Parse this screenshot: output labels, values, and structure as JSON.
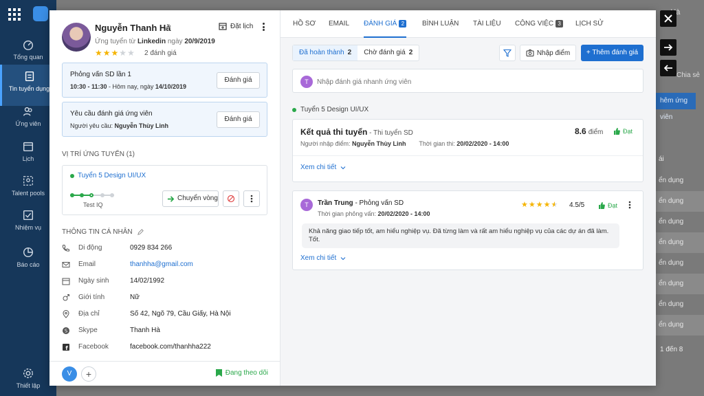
{
  "background": {
    "sidebar": [
      {
        "label": "Tổng quan",
        "icon": "dashboard-icon"
      },
      {
        "label": "Tin tuyển dụng",
        "icon": "jobs-icon"
      },
      {
        "label": "Ứng viên",
        "icon": "candidates-icon"
      },
      {
        "label": "Lịch",
        "icon": "calendar-icon"
      },
      {
        "label": "Talent pools",
        "icon": "talent-pool-icon"
      },
      {
        "label": "Nhiệm vụ",
        "icon": "tasks-icon"
      },
      {
        "label": "Báo cáo",
        "icon": "report-icon"
      },
      {
        "label": "Thiết lập",
        "icon": "settings-icon"
      }
    ],
    "topright_text": "ng Hà",
    "share_text": "Chia sẻ",
    "add_candidate_button": "hêm ứng viên",
    "col_header": "ái",
    "rows": [
      "ển dụng",
      "ển dụng",
      "ển dụng",
      "ển dụng",
      "ển dụng",
      "ển dụng",
      "ển dụng",
      "ển dụng",
      "ển dụng"
    ],
    "pager": "1 đến 8"
  },
  "candidate": {
    "name": "Nguyễn Thanh Hà",
    "applied_prefix": "Ứng tuyển từ",
    "source": "Linkedin",
    "applied_mid": "ngày",
    "applied_date": "20/9/2019",
    "rating_stars": 3,
    "rating_label": "2 đánh giá",
    "schedule_label": "Đặt lịch"
  },
  "interview_card": {
    "title": "Phỏng vấn SD lần 1",
    "time": "10:30 - 11:30",
    "day_prefix": " - Hôm nay, ngày ",
    "date": "14/10/2019",
    "button": "Đánh giá"
  },
  "request_card": {
    "title": "Yêu cầu đánh giá ứng viên",
    "requester_prefix": "Người yêu cầu: ",
    "requester": "Nguyễn Thùy Linh",
    "button": "Đánh giá"
  },
  "position": {
    "section_title": "VỊ TRÍ ỨNG TUYỂN (1)",
    "name": "Tuyển 5 Design UI/UX",
    "current_step": "Test IQ",
    "move_button": "Chuyển vòng"
  },
  "personal": {
    "section_title": "THÔNG TIN CÁ NHÂN",
    "fields": [
      {
        "label": "Di động",
        "value": "0929 834 266",
        "icon": "phone-icon"
      },
      {
        "label": "Email",
        "value": "thanhha@gmail.com",
        "icon": "mail-icon"
      },
      {
        "label": "Ngày sinh",
        "value": "14/02/1992",
        "icon": "calendar-icon"
      },
      {
        "label": "Giới tính",
        "value": "Nữ",
        "icon": "gender-icon"
      },
      {
        "label": "Địa chỉ",
        "value": "Số 42, Ngõ 79, Cầu Giấy, Hà Nội",
        "icon": "location-icon"
      },
      {
        "label": "Skype",
        "value": "Thanh Hà",
        "icon": "skype-icon"
      },
      {
        "label": "Facebook",
        "value": "facebook.com/thanhha222",
        "icon": "facebook-icon"
      }
    ]
  },
  "footer": {
    "avatar_initial": "V",
    "follow_label": "Đang theo dõi"
  },
  "tabs": [
    {
      "label": "HỒ SƠ"
    },
    {
      "label": "EMAIL"
    },
    {
      "label": "ĐÁNH GIÁ",
      "badge": "2"
    },
    {
      "label": "BÌNH LUẬN"
    },
    {
      "label": "TÀI LIỆU"
    },
    {
      "label": "CÔNG VIỆC",
      "badge": "3"
    },
    {
      "label": "LỊCH SỬ"
    }
  ],
  "filters": {
    "completed_label": "Đã hoàn thành",
    "completed_count": "2",
    "pending_label": "Chờ đánh giá",
    "pending_count": "2",
    "import_score": "Nhập điểm",
    "add_eval": "+ Thêm đánh giá"
  },
  "quick_eval": {
    "avatar_initial": "T",
    "placeholder": "Nhập đánh giá nhanh ứng viên"
  },
  "group_label": "Tuyển 5 Design UI/UX",
  "result": {
    "title": "Kết quả thi tuyển",
    "subtitle": " - Thi tuyển SD",
    "entered_by_label": "Người nhập điểm: ",
    "entered_by": "Nguyễn Thùy Linh",
    "exam_time_label": "Thời gian thi: ",
    "exam_time": "20/02/2020 - 14:00",
    "score": "8.6",
    "score_unit": "điểm",
    "status": "Đạt",
    "more": "Xem chi tiết"
  },
  "evaluation": {
    "avatar_initial": "T",
    "reviewer": "Trần Trung",
    "stage": " - Phỏng vấn SD",
    "time_label": "Thời gian phỏng vấn: ",
    "time": "20/02/2020 - 14:00",
    "stars": 4.5,
    "score": "4.5/5",
    "status": "Đạt",
    "comment": "Khả năng giao tiếp tốt, am hiểu nghiệp vụ. Đã từng làm và rất am hiểu nghiệp vụ của các dự án đã làm. Tốt.",
    "more": "Xem chi tiết"
  },
  "colors": {
    "primary": "#1e6fd0",
    "success": "#2aa84a",
    "star": "#f5b400",
    "sidebar": "#16375a"
  }
}
